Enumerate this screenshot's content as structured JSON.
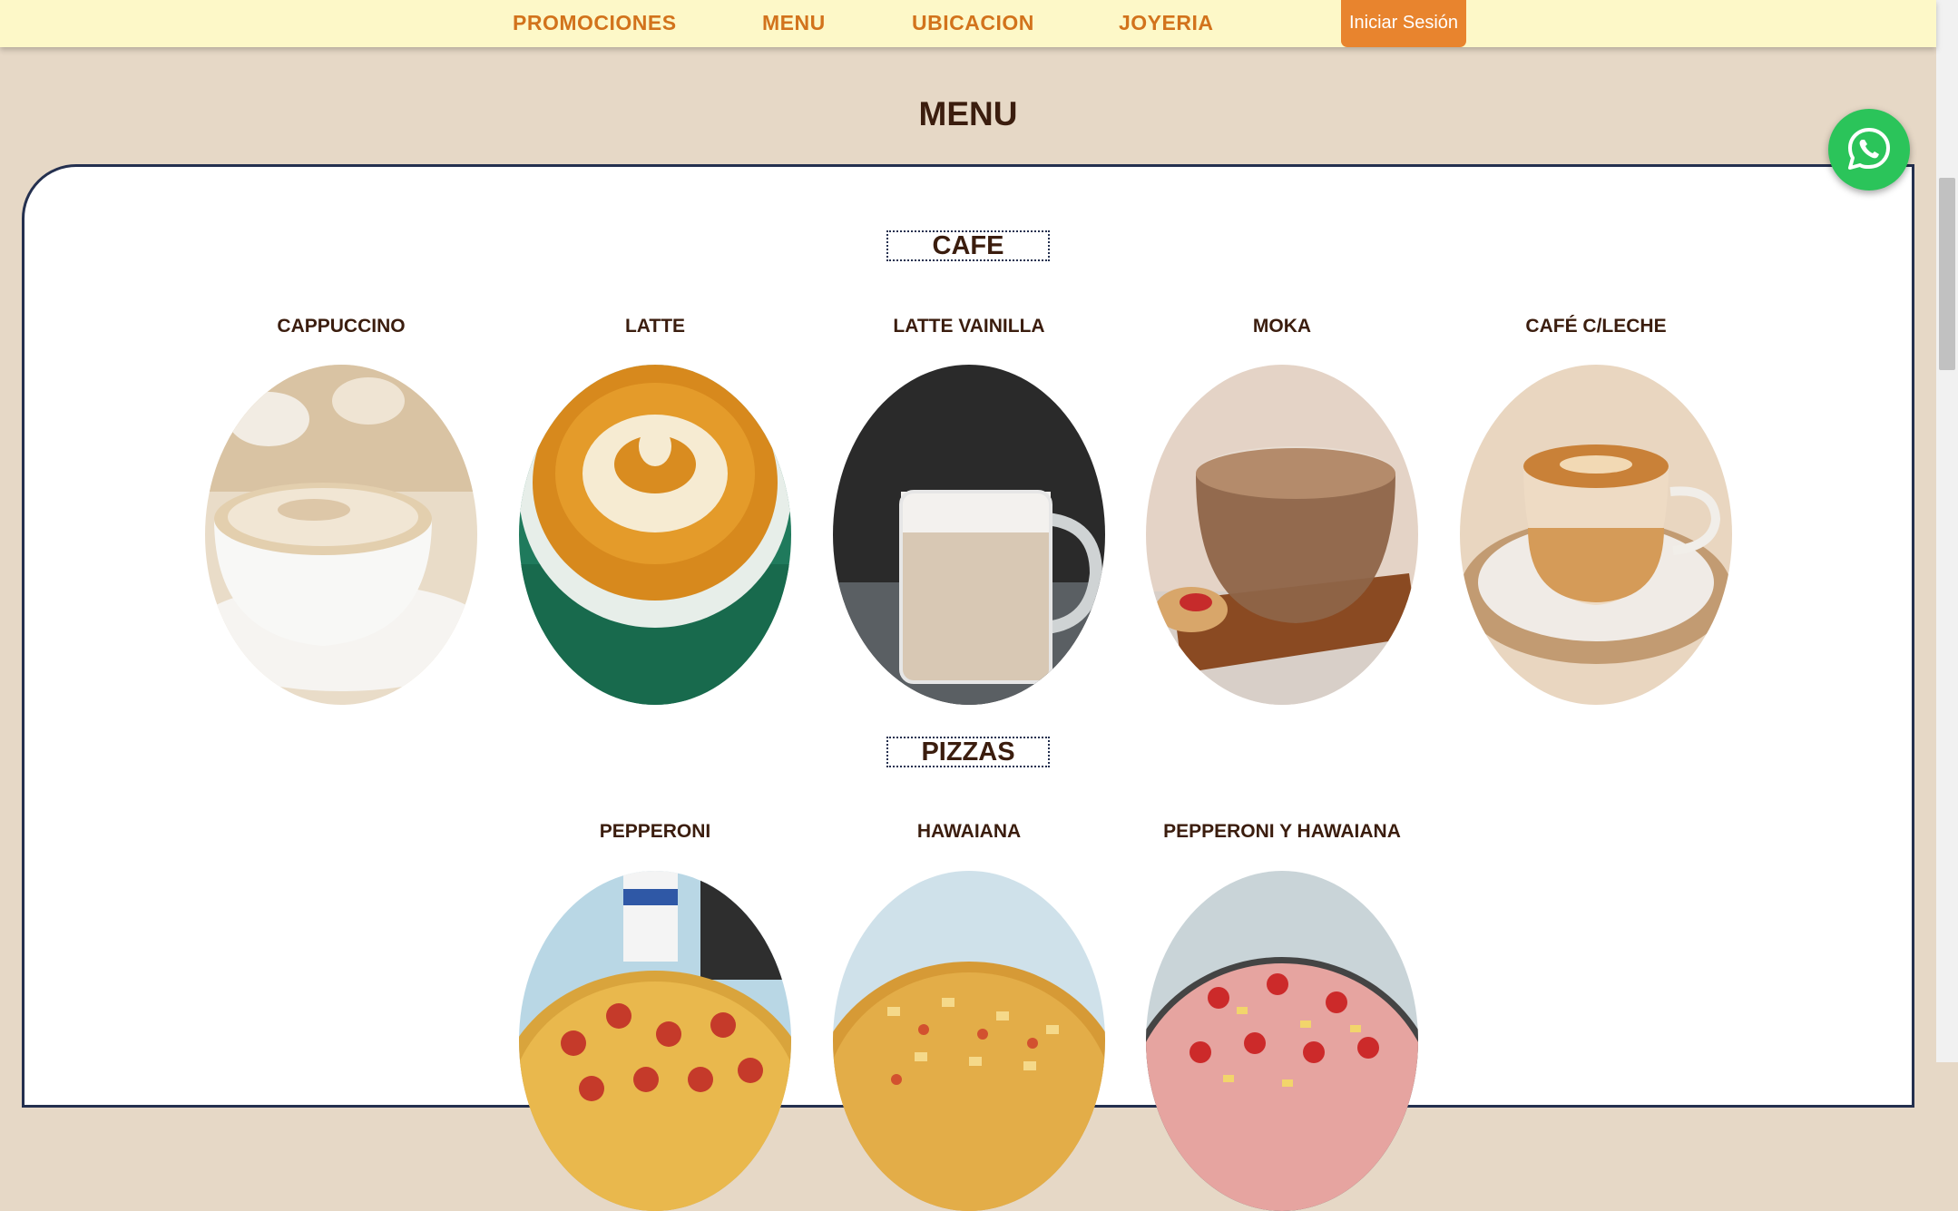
{
  "nav": {
    "links": [
      "PROMOCIONES",
      "MENU",
      "UBICACION",
      "JOYERIA"
    ],
    "login_label": "Iniciar Sesión"
  },
  "page_title": "MENU",
  "categories": [
    {
      "title": "CAFE",
      "items": [
        {
          "name": "CAPPUCCINO"
        },
        {
          "name": "LATTE"
        },
        {
          "name": "LATTE VAINILLA"
        },
        {
          "name": "MOKA"
        },
        {
          "name": "CAFÉ C/LECHE"
        }
      ]
    },
    {
      "title": "PIZZAS",
      "items": [
        {
          "name": "PEPPERONI"
        },
        {
          "name": "HAWAIANA"
        },
        {
          "name": "PEPPERONI Y HAWAIANA"
        }
      ]
    }
  ],
  "whatsapp": {
    "icon": "whatsapp-icon"
  },
  "colors": {
    "nav_bg": "#fdf8c8",
    "nav_link": "#d2731c",
    "login_bg": "#e8842e",
    "page_bg": "#e6d8c6",
    "title_text": "#3b1d0e",
    "panel_border": "#24304f",
    "whatsapp_green": "#2bc45a"
  }
}
